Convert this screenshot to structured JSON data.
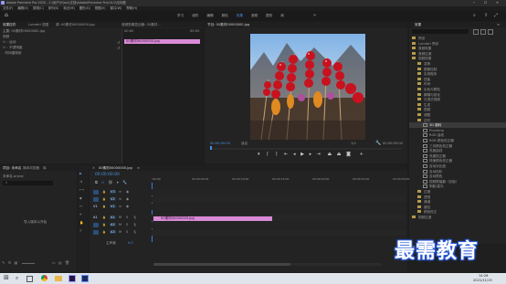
{
  "window": {
    "title": "Adobe Premiere Pro 2020 - C:\\用户\\V\\bcz\\文档\\Adobe\\Premiere Pro\\14.0\\无标题"
  },
  "menu": [
    "文件(F)",
    "编辑(E)",
    "剪辑(C)",
    "序列(S)",
    "标记(M)",
    "图形(G)",
    "视图(V)",
    "窗口(W)",
    "帮助(H)"
  ],
  "workspaces": [
    "学习",
    "组件",
    "编辑",
    "颜色",
    "效果",
    "音频",
    "图形",
    "库"
  ],
  "active_workspace": "效果",
  "effect_controls": {
    "tabs": [
      "效果控件",
      "Lumetri 范围",
      "源: 00素材00000000.jpg",
      "音频剪辑混合器: 00素材..."
    ],
    "clip_label": "主要: 00素材00000000.jpg",
    "items": [
      "视频",
      "运动",
      "不透明度",
      "时间重映射"
    ],
    "clip_timecode": "00:00",
    "clip_name_bar": "00素材00000000.jpg"
  },
  "program_monitor": {
    "tab": "节目: 00素材00000000.jpg",
    "timecode_current": "00:00:00:00",
    "fit": "适合",
    "quality": "1/2",
    "timecode_end": "00:00:05:00"
  },
  "project": {
    "tabs": [
      "项目: 未命名",
      "媒体浏览器",
      "库"
    ],
    "file": "未命名.prproj",
    "empty_label": "导入媒体以开始"
  },
  "timeline": {
    "tab": "00素材00000000.jpg",
    "timecode": "00:00:00:00",
    "ruler": [
      ":00:00",
      "00:00:05:00",
      "00:00:10:00",
      "00:00:15:00",
      "00:00:20:00",
      "00:00:25:00",
      "00:00:30:00"
    ],
    "video_tracks": [
      "V3",
      "V2",
      "V1"
    ],
    "audio_tracks": [
      "A1",
      "A2",
      "A3"
    ],
    "master": "主声道",
    "master_value": "0.0",
    "clip_label": "00素材00000000.jpg",
    "clip_color": "#d98ad6"
  },
  "effects_panel": {
    "tab": "效果",
    "folders": [
      "预设",
      "Lumetri 预设",
      "音频效果",
      "音频过渡",
      "视频效果",
      "变换",
      "图像控制",
      "实用程序",
      "扭曲",
      "时间",
      "杂色与颗粒",
      "模糊与锐化",
      "沉浸式视频",
      "生成",
      "视频",
      "调整",
      "过时"
    ],
    "effects": [
      "3D 翻转",
      "ProcAmp",
      "RGB 曲线",
      "RGB 颜色校正器",
      "三向颜色校正器",
      "亮度曲线",
      "亮度校正器",
      "快速颜色校正器",
      "自动对比度",
      "自动色阶",
      "自动颜色",
      "视频限幅器（旧版）",
      "阴影/高光"
    ],
    "trailing_folders": [
      "过渡",
      "透视",
      "通道",
      "键控",
      "颜色校正"
    ],
    "video_transitions": "视频过渡",
    "basic_sound": "基本声音"
  },
  "watermark": "最需教育",
  "taskbar": {
    "time": "14:26",
    "date": "2021/11/19"
  },
  "colors": {
    "accent": "#4a90e2",
    "clip_pink": "#d98ad6",
    "playhead": "#3a7be0"
  }
}
